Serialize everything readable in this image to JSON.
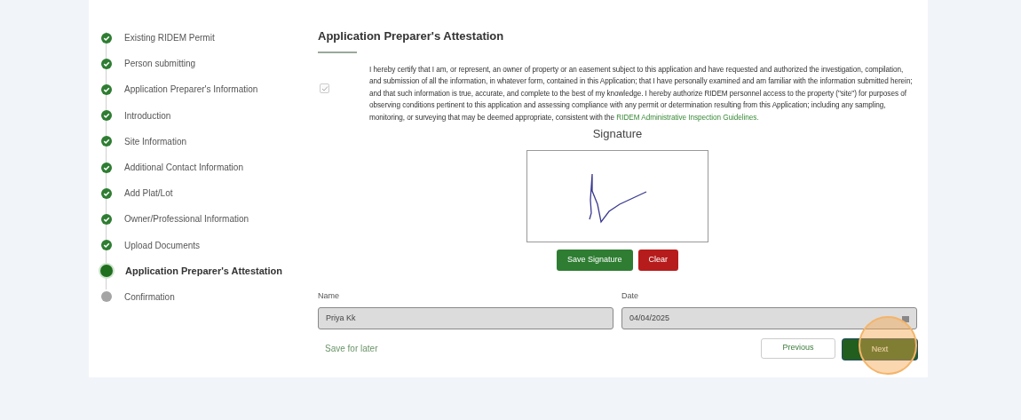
{
  "steps": [
    {
      "label": "Existing RIDEM Permit",
      "kind": "done"
    },
    {
      "label": "Person submitting",
      "kind": "done"
    },
    {
      "label": "Application Preparer's Information",
      "kind": "done"
    },
    {
      "label": "Introduction",
      "kind": "done"
    },
    {
      "label": "Site Information",
      "kind": "done"
    },
    {
      "label": "Additional Contact Information",
      "kind": "done"
    },
    {
      "label": "Add Plat/Lot",
      "kind": "done"
    },
    {
      "label": "Owner/Professional Information",
      "kind": "done"
    },
    {
      "label": "Upload Documents",
      "kind": "done"
    },
    {
      "label": "Application Preparer's Attestation",
      "kind": "current"
    },
    {
      "label": "Confirmation",
      "kind": "pending"
    }
  ],
  "section": {
    "title": "Application Preparer's Attestation"
  },
  "attestation": {
    "checked": true,
    "text": "I hereby certify that I am, or represent, an owner of property or an easement subject to this application and have requested and authorized the investigation, compilation, and submission of all the information, in whatever form, contained in this Application; that I have personally examined and am familiar with the information submitted herein; and that such information is true, accurate, and complete to the best of my knowledge. I hereby authorize RIDEM personnel access to the property (\"site\") for purposes of observing conditions pertinent to this application and assessing compliance with any permit or determination resulting from this Application; including any sampling, monitoring, or surveying that may be deemed appropriate, consistent with the ",
    "link": "RIDEM Administrative Inspection Guidelines."
  },
  "signature": {
    "title": "Signature",
    "save": "Save Signature",
    "clear": "Clear"
  },
  "fields": [
    {
      "label": "Name",
      "value": "Priya Kk",
      "kind": "text"
    },
    {
      "label": "Date",
      "value": "04/04/2025",
      "kind": "date"
    }
  ],
  "footer": {
    "save_later": "Save for later",
    "previous": "Previous",
    "next": "Next"
  },
  "click_highlight": {
    "on": true
  }
}
